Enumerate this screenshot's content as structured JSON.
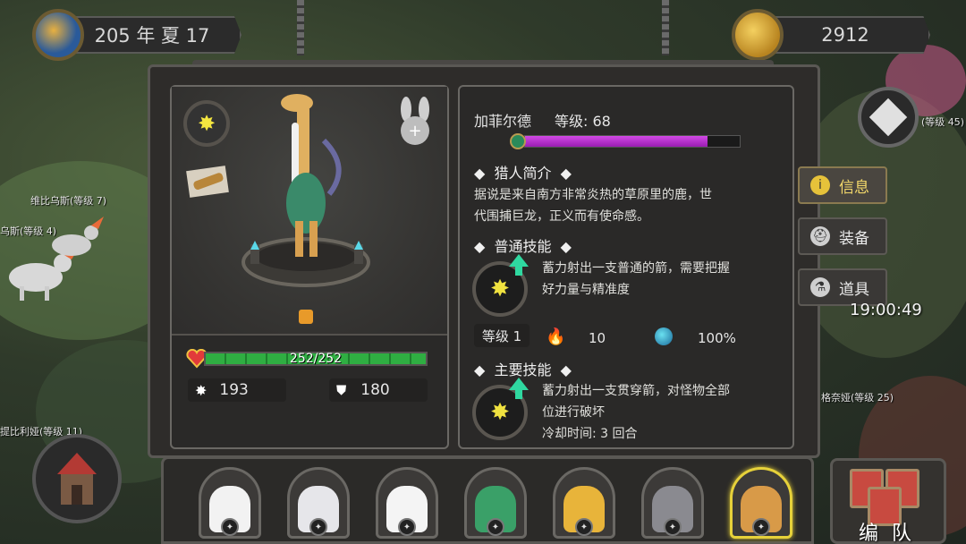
{
  "hud": {
    "date": "205 年 夏 17",
    "gold": "2912",
    "clock": "19:00:49"
  },
  "map_labels": [
    "维比乌斯(等级 7)",
    "乌斯(等级 4)",
    "(等级 45)",
    "格奈娅(等级 25)",
    "提比利娅(等级 11)"
  ],
  "hero": {
    "name": "加菲尔德",
    "level_label": "等级: 68",
    "level_progress": 0.85,
    "hp_text": "252/252",
    "hp_fraction": 1.0,
    "attack": "193",
    "defense": "180"
  },
  "bio": {
    "title": "猎人简介",
    "text_line1": "据说是来自南方非常炎热的草原里的鹿，世",
    "text_line2": "代围捕巨龙，正义而有使命感。"
  },
  "normal_skill": {
    "title": "普通技能",
    "desc_line1": "蓄力射出一支普通的箭，需要把握",
    "desc_line2": "好力量与精准度",
    "level_tag": "等级 1",
    "fire_value": "10",
    "rate_value": "100%"
  },
  "main_skill": {
    "title": "主要技能",
    "desc_line1": "蓄力射出一支贯穿箭，对怪物全部",
    "desc_line2": "位进行破坏",
    "cooldown": "冷却时间: 3 回合"
  },
  "tabs": {
    "info": "信息",
    "equip": "装备",
    "items": "道具"
  },
  "team_button": "编 队",
  "roster_colors": [
    "#f2f2f2",
    "#e6e6ea",
    "#f4f4f4",
    "#3aa068",
    "#e8b43a",
    "#8a8a90",
    "#d89a48"
  ],
  "colors": {
    "hp_green": "#2fae42",
    "level_purple": "#c23ad8",
    "accent_gold": "#e6d13a"
  }
}
